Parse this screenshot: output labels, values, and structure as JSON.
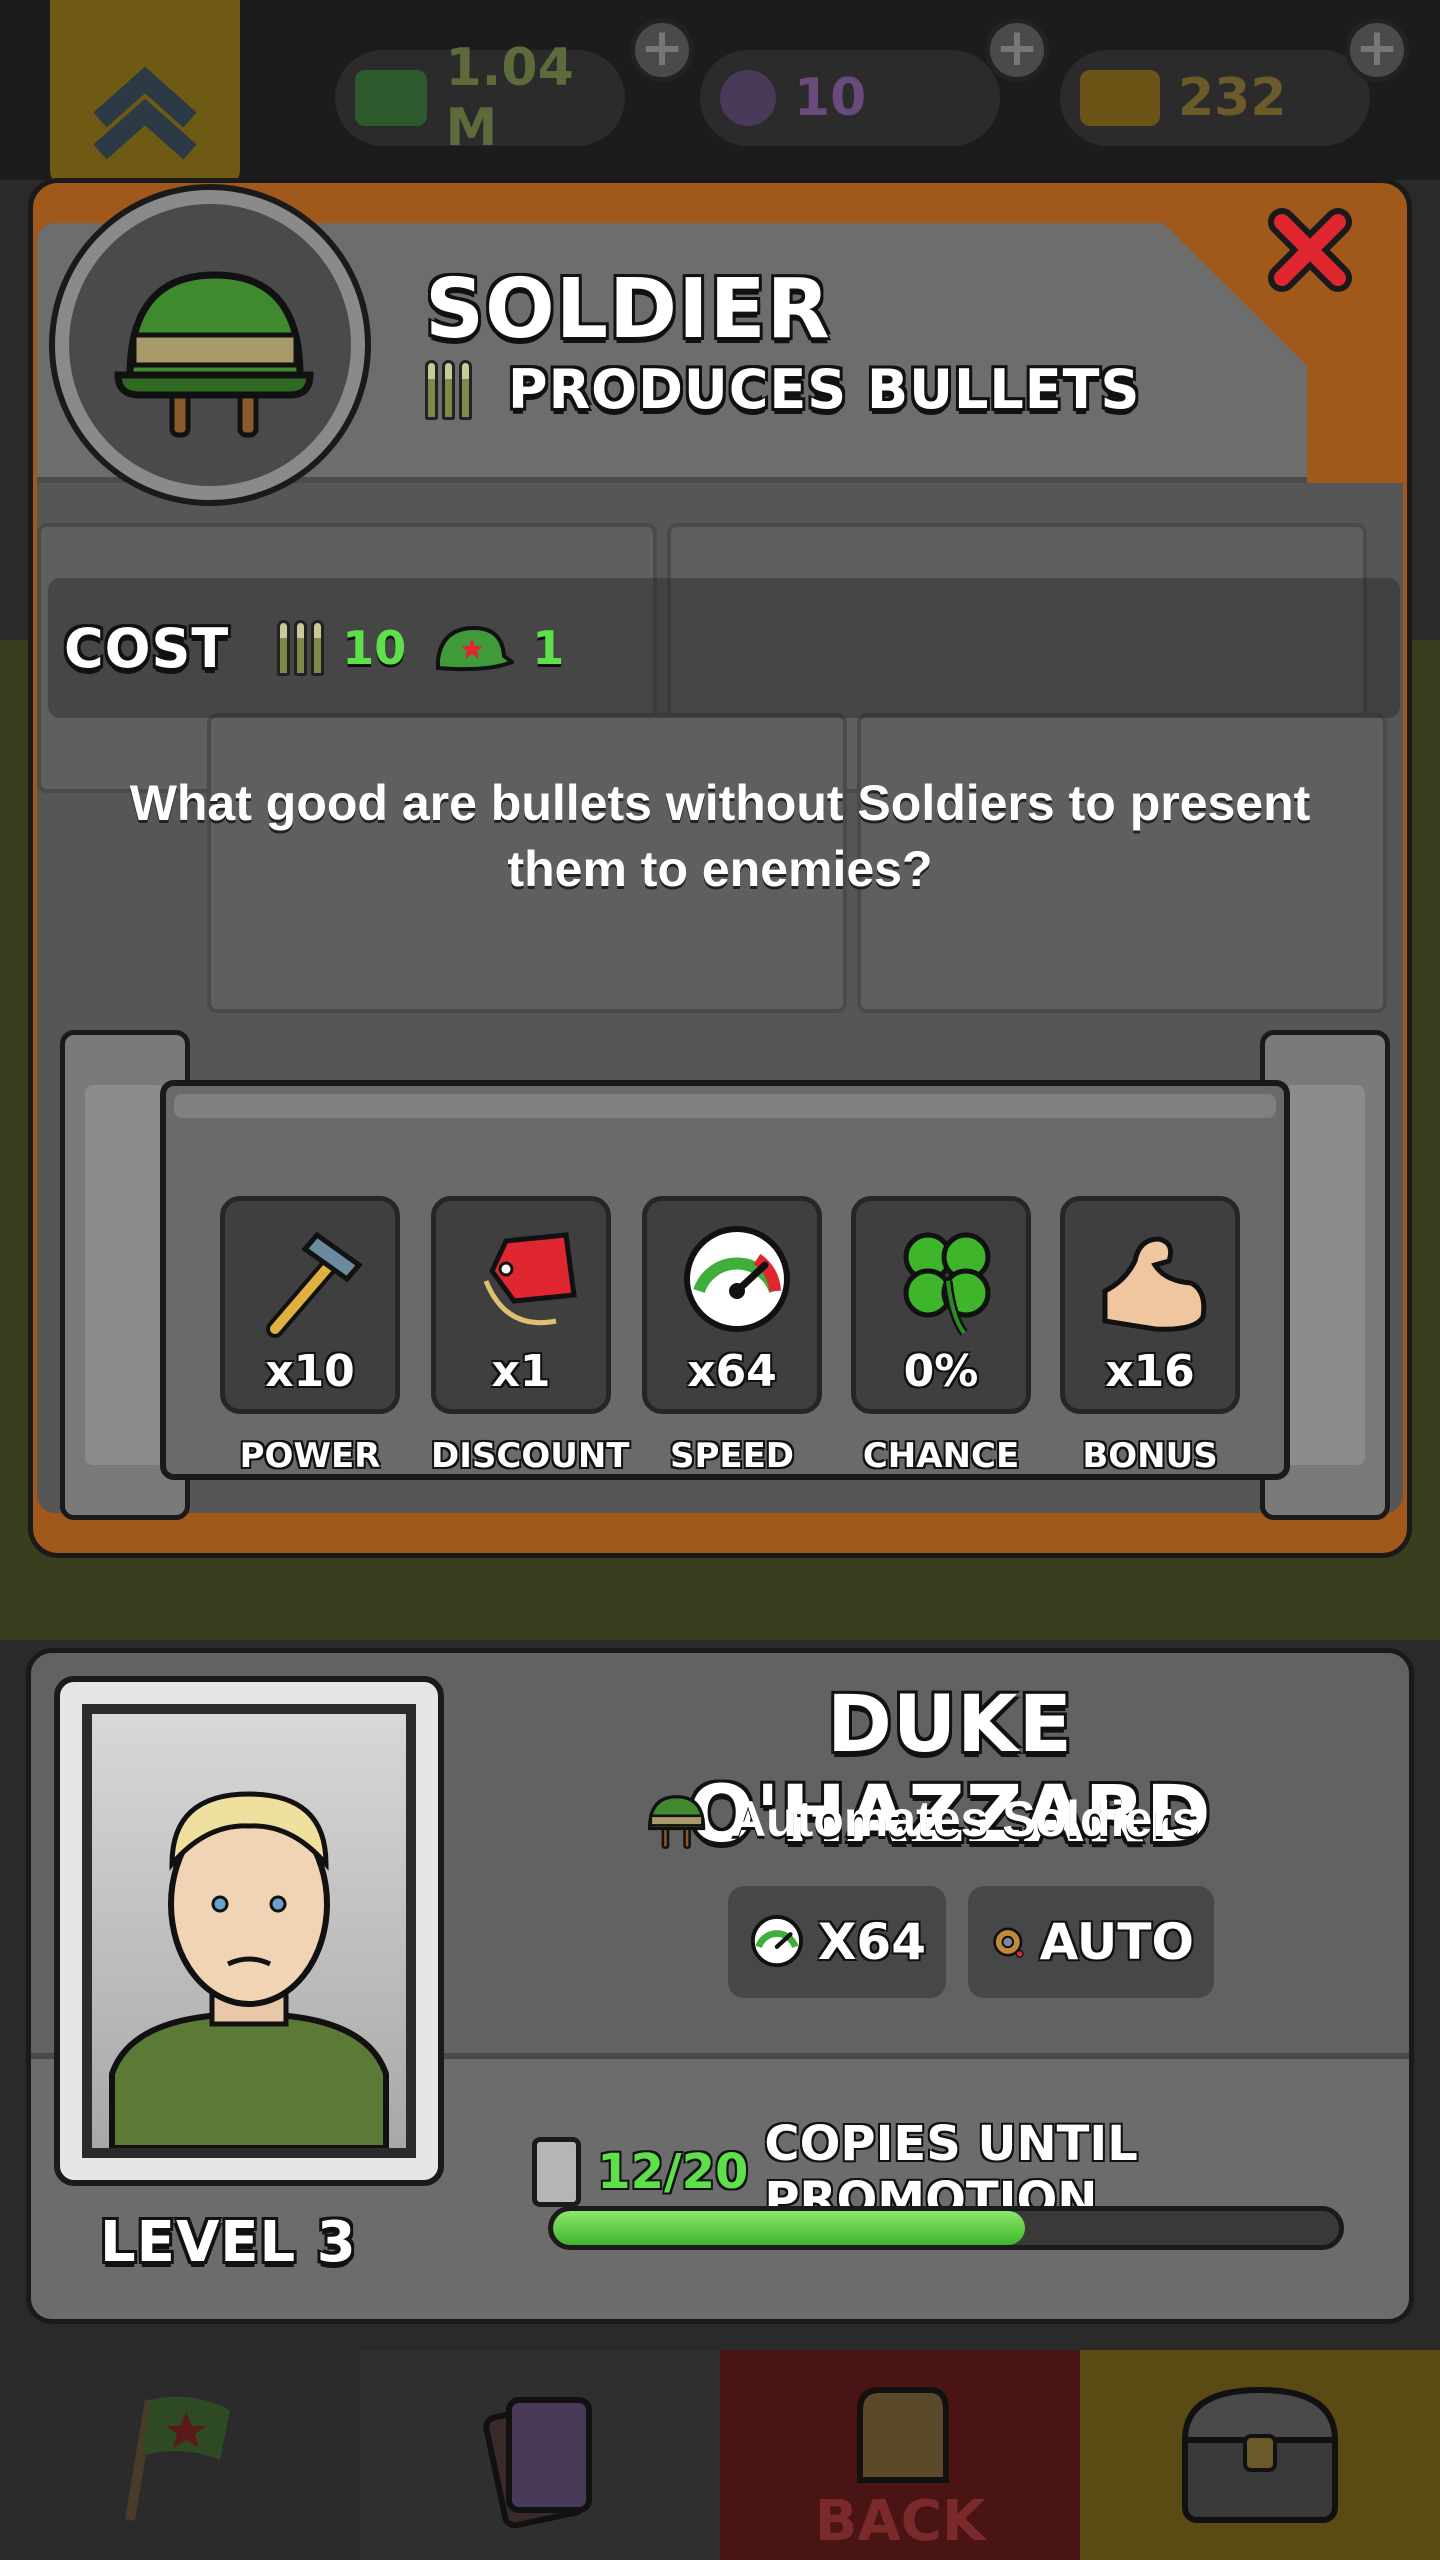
{
  "resources": {
    "caps": "1.04 M",
    "potion": "10",
    "gold": "232",
    "plus": "+"
  },
  "modal": {
    "title": "SOLDIER",
    "subtitle": "PRODUCES BULLETS",
    "cost_label": "COST",
    "cost_bullets": "10",
    "cost_caps": "1",
    "description": "What good are bullets without Soldiers to present them to enemies?",
    "stats": [
      {
        "label": "POWER",
        "value": "x10",
        "icon": "hammer-icon"
      },
      {
        "label": "DISCOUNT",
        "value": "x1",
        "icon": "price-tag-icon"
      },
      {
        "label": "SPEED",
        "value": "x64",
        "icon": "speedometer-icon"
      },
      {
        "label": "CHANCE",
        "value": "0%",
        "icon": "clover-icon"
      },
      {
        "label": "BONUS",
        "value": "x16",
        "icon": "bicep-icon"
      }
    ]
  },
  "hero": {
    "name": "DUKE O'HAZZARD",
    "subtitle": "Automates Soldiers",
    "level": "LEVEL 3",
    "speed_chip": "X64",
    "auto_chip": "AUTO",
    "copies_count": "12/20",
    "copies_label": "COPIES UNTIL PROMOTION",
    "copies_progress": 0.6
  },
  "nav": {
    "back_label": "BACK"
  },
  "colors": {
    "accent_green": "#5ee04a",
    "frame_orange": "#a0591b",
    "close_red": "#e0262e"
  }
}
